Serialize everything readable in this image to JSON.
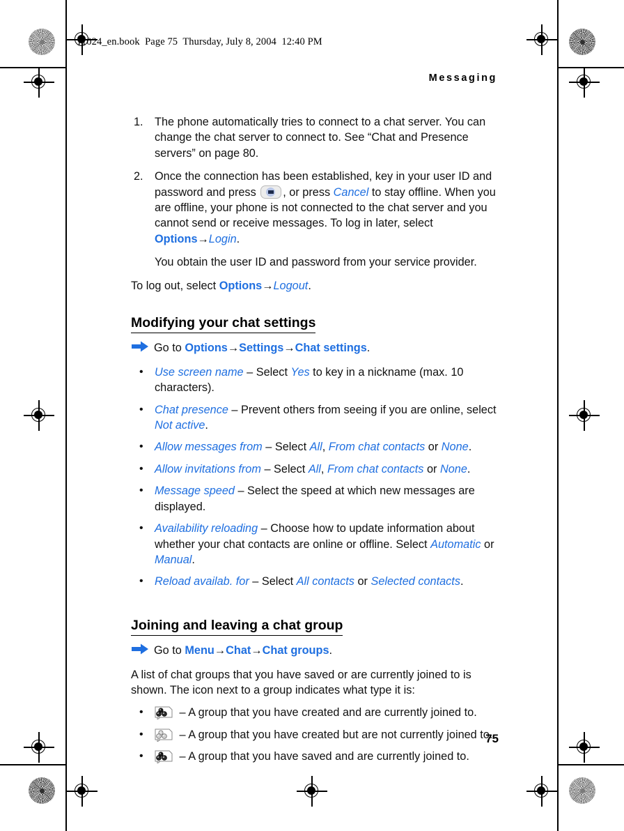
{
  "print_header": {
    "text": "r1024_en.book  Page 75  Thursday, July 8, 2004  12:40 PM"
  },
  "running_head": "Messaging",
  "page_number": "75",
  "colors": {
    "link_blue": "#1f6fe0",
    "text_black": "#111111",
    "key_icon_fill": "#1d2a4a",
    "key_icon_circle": "#b9c7e8"
  },
  "steps": [
    {
      "num": "1.",
      "parts": [
        {
          "type": "text",
          "value": "The phone automatically tries to connect to a chat server. You can change the chat server to connect to. See “Chat and Presence servers” on page 80."
        }
      ]
    },
    {
      "num": "2.",
      "parts": [
        {
          "type": "text",
          "value": "Once the connection has been established, key in your user ID and password and press "
        },
        {
          "type": "key-icon",
          "value": "select-key-icon"
        },
        {
          "type": "text",
          "value": ", or press "
        },
        {
          "type": "blue-italic",
          "value": "Cancel"
        },
        {
          "type": "text",
          "value": " to stay offline. When you are offline, your phone is not connected to the chat server and you cannot send or receive messages. To log in later, select "
        },
        {
          "type": "blue-bold",
          "value": "Options"
        },
        {
          "type": "arrow",
          "value": "→"
        },
        {
          "type": "blue-italic",
          "value": "Login"
        },
        {
          "type": "text",
          "value": "."
        }
      ]
    }
  ],
  "step_note": "You obtain the user ID and password from your service provider.",
  "logout_para": [
    {
      "type": "text",
      "value": "To log out, select "
    },
    {
      "type": "blue-bold",
      "value": "Options"
    },
    {
      "type": "arrow",
      "value": "→"
    },
    {
      "type": "blue-italic",
      "value": "Logout"
    },
    {
      "type": "text",
      "value": "."
    }
  ],
  "section1": {
    "heading": "Modifying your chat settings",
    "goto": [
      {
        "type": "text",
        "value": "Go to "
      },
      {
        "type": "blue-bold",
        "value": "Options"
      },
      {
        "type": "arrow",
        "value": "→"
      },
      {
        "type": "blue-bold",
        "value": "Settings"
      },
      {
        "type": "arrow",
        "value": "→"
      },
      {
        "type": "blue-bold",
        "value": "Chat settings"
      },
      {
        "type": "text",
        "value": "."
      }
    ],
    "bullets": [
      [
        {
          "type": "blue-italic",
          "value": "Use screen name"
        },
        {
          "type": "text",
          "value": " – Select "
        },
        {
          "type": "blue-italic",
          "value": "Yes"
        },
        {
          "type": "text",
          "value": " to key in a nickname (max. 10 characters)."
        }
      ],
      [
        {
          "type": "blue-italic",
          "value": "Chat presence"
        },
        {
          "type": "text",
          "value": " – Prevent others from seeing if you are online, select "
        },
        {
          "type": "blue-italic",
          "value": "Not active"
        },
        {
          "type": "text",
          "value": "."
        }
      ],
      [
        {
          "type": "blue-italic",
          "value": "Allow messages from"
        },
        {
          "type": "text",
          "value": " – Select "
        },
        {
          "type": "blue-italic",
          "value": "All"
        },
        {
          "type": "text",
          "value": ", "
        },
        {
          "type": "blue-italic",
          "value": "From chat contacts"
        },
        {
          "type": "text",
          "value": " or "
        },
        {
          "type": "blue-italic",
          "value": "None"
        },
        {
          "type": "text",
          "value": "."
        }
      ],
      [
        {
          "type": "blue-italic",
          "value": "Allow invitations from"
        },
        {
          "type": "text",
          "value": " – Select "
        },
        {
          "type": "blue-italic",
          "value": "All"
        },
        {
          "type": "text",
          "value": ", "
        },
        {
          "type": "blue-italic",
          "value": "From chat contacts"
        },
        {
          "type": "text",
          "value": " or "
        },
        {
          "type": "blue-italic",
          "value": "None"
        },
        {
          "type": "text",
          "value": "."
        }
      ],
      [
        {
          "type": "blue-italic",
          "value": "Message speed"
        },
        {
          "type": "text",
          "value": " – Select the speed at which new messages are displayed."
        }
      ],
      [
        {
          "type": "blue-italic",
          "value": "Availability reloading"
        },
        {
          "type": "text",
          "value": " – Choose how to update information about whether your chat contacts are online or offline. Select "
        },
        {
          "type": "blue-italic",
          "value": "Automatic"
        },
        {
          "type": "text",
          "value": " or "
        },
        {
          "type": "blue-italic",
          "value": "Manual"
        },
        {
          "type": "text",
          "value": "."
        }
      ],
      [
        {
          "type": "blue-italic",
          "value": "Reload availab. for"
        },
        {
          "type": "text",
          "value": " – Select "
        },
        {
          "type": "blue-italic",
          "value": "All contacts"
        },
        {
          "type": "text",
          "value": " or "
        },
        {
          "type": "blue-italic",
          "value": "Selected contacts"
        },
        {
          "type": "text",
          "value": "."
        }
      ]
    ]
  },
  "section2": {
    "heading": "Joining and leaving a chat group",
    "goto": [
      {
        "type": "text",
        "value": "Go to "
      },
      {
        "type": "blue-bold",
        "value": "Menu"
      },
      {
        "type": "arrow",
        "value": "→"
      },
      {
        "type": "blue-bold",
        "value": "Chat"
      },
      {
        "type": "arrow",
        "value": "→"
      },
      {
        "type": "blue-bold",
        "value": "Chat groups"
      },
      {
        "type": "text",
        "value": "."
      }
    ],
    "intro": "A list of chat groups that you have saved or are currently joined to is shown. The icon next to a group indicates what type it is:",
    "bullets": [
      [
        {
          "type": "group-icon",
          "value": "chat-group-created-joined-icon"
        },
        {
          "type": "text",
          "value": " – A group that you have created and are currently joined to."
        }
      ],
      [
        {
          "type": "group-icon",
          "value": "chat-group-created-not-joined-icon"
        },
        {
          "type": "text",
          "value": " – A group that you have created but are not currently joined to."
        }
      ],
      [
        {
          "type": "group-icon",
          "value": "chat-group-saved-joined-icon"
        },
        {
          "type": "text",
          "value": " – A group that you have saved and are currently joined to."
        }
      ]
    ]
  }
}
